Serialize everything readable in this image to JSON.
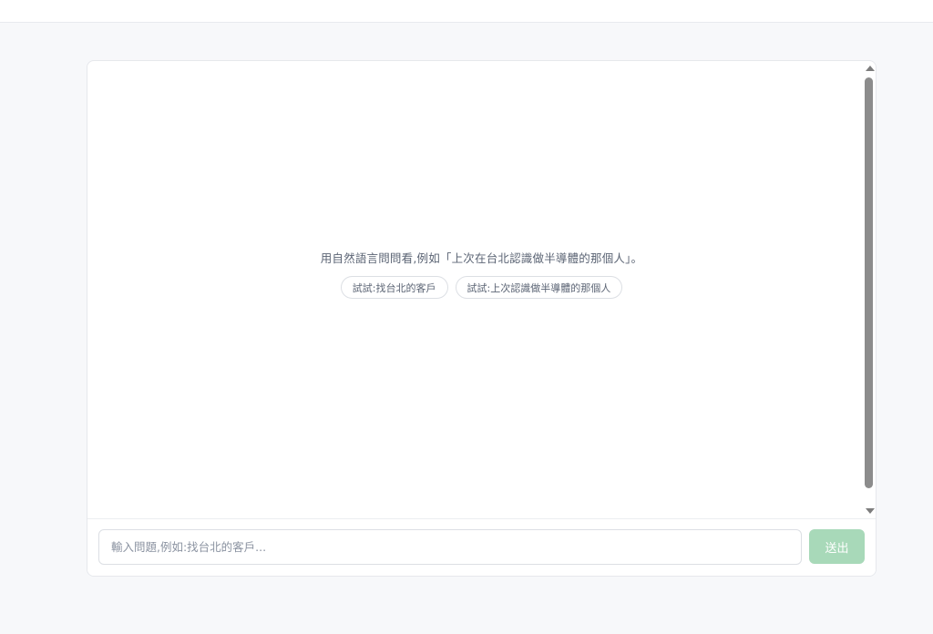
{
  "chat": {
    "empty_hint": "用自然語言問問看,例如「上次在台北認識做半導體的那個人」。",
    "suggestions": [
      "試試:找台北的客戶",
      "試試:上次認識做半導體的那個人"
    ]
  },
  "composer": {
    "input_placeholder": "輸入問題,例如:找台北的客戶...",
    "input_value": "",
    "send_label": "送出"
  },
  "colors": {
    "page_background": "#f7f8fa",
    "send_button": "#a8d9b9",
    "scrollbar_thumb": "#8c8c8c"
  }
}
